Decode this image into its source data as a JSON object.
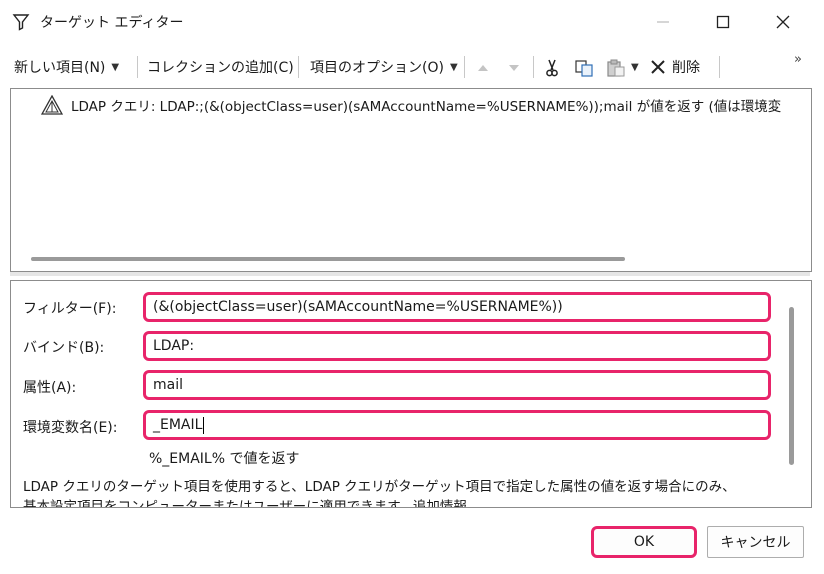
{
  "window": {
    "title": "ターゲット エディター",
    "icons": {
      "title": "filter-funnel-icon",
      "minimize": "minimize-icon",
      "maximize": "maximize-icon",
      "close": "close-icon"
    }
  },
  "toolbar": {
    "new_item": "新しい項目(N)",
    "add_collection": "コレクションの追加(C)",
    "item_options": "項目のオプション(O)",
    "delete": "削除",
    "overflow": "»",
    "icons": [
      "up-arrow-icon",
      "down-arrow-icon",
      "cut-icon",
      "copy-icon",
      "paste-icon",
      "delete-x-icon"
    ]
  },
  "list": {
    "items": [
      {
        "icon": "ldap-query-icon",
        "text": "LDAP クエリ: LDAP:;(&(objectClass=user)(sAMAccountName=%USERNAME%));mail が値を返す (値は環境変"
      }
    ]
  },
  "properties": {
    "filter": {
      "label": "フィルター(F):",
      "value": "(&(objectClass=user)(sAMAccountName=%USERNAME%))"
    },
    "bind": {
      "label": "バインド(B):",
      "value": "LDAP:"
    },
    "attribute": {
      "label": "属性(A):",
      "value": "mail"
    },
    "env_var": {
      "label": "環境変数名(E):",
      "value": "_EMAIL"
    },
    "result_text": "%_EMAIL% で値を返す",
    "description_line1": "LDAP クエリのターゲット項目を使用すると、LDAP クエリがターゲット項目で指定した属性の値を返す場合にのみ、",
    "description_line2": "基本設定項目をコンピューターまたはユーザーに適用できます。追加情報"
  },
  "buttons": {
    "ok": "OK",
    "cancel": "キャンセル"
  },
  "colors": {
    "highlight": "#e8246a",
    "border": "#8c8c8c"
  }
}
